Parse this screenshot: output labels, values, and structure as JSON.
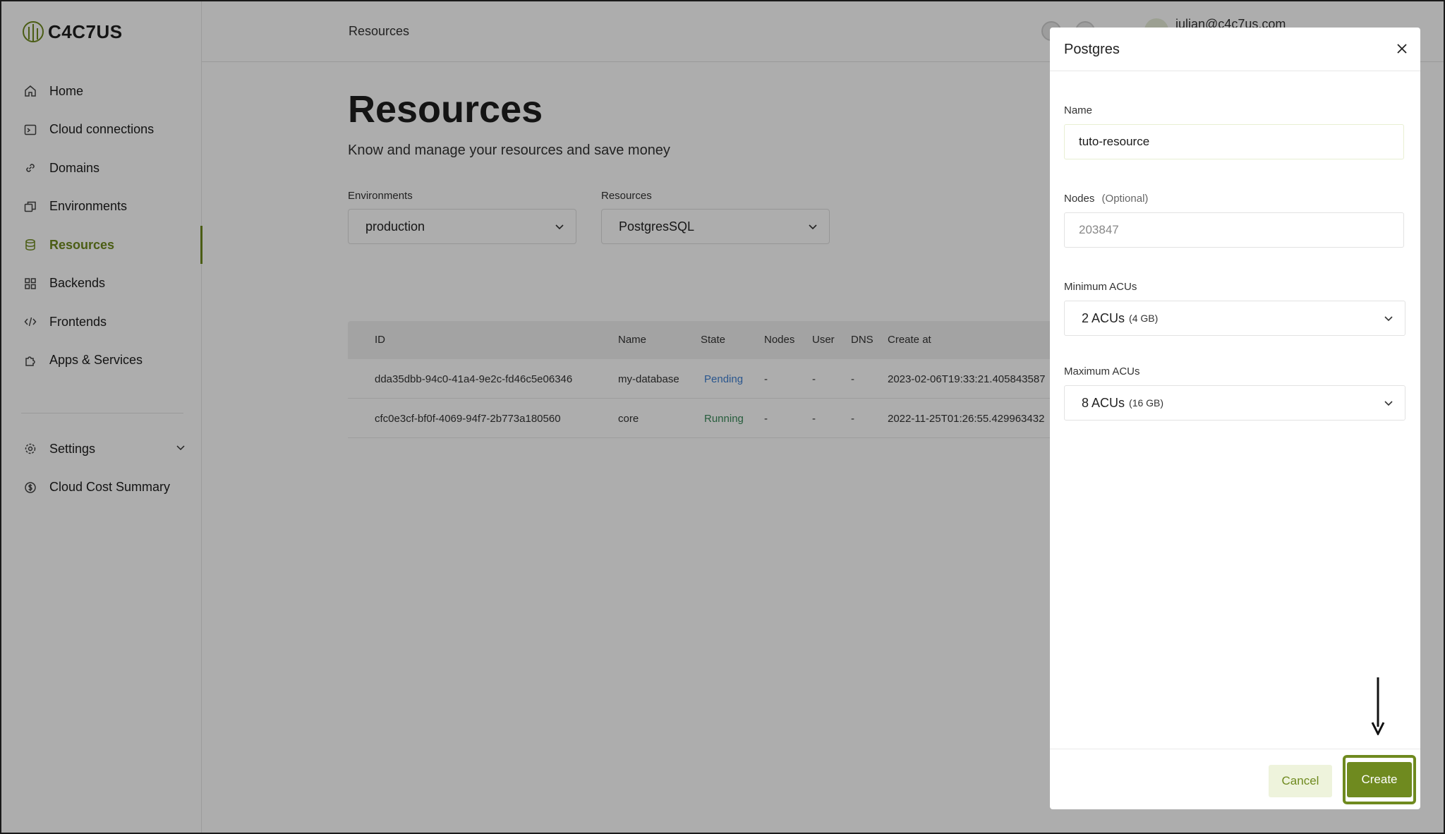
{
  "app": {
    "logo_text": "C4C7US"
  },
  "sidebar": {
    "items": [
      {
        "label": "Home",
        "icon": "home-icon"
      },
      {
        "label": "Cloud connections",
        "icon": "terminal-icon"
      },
      {
        "label": "Domains",
        "icon": "link-icon"
      },
      {
        "label": "Environments",
        "icon": "layers-icon"
      },
      {
        "label": "Resources",
        "icon": "database-icon",
        "active": true
      },
      {
        "label": "Backends",
        "icon": "grid-icon"
      },
      {
        "label": "Frontends",
        "icon": "code-icon"
      },
      {
        "label": "Apps & Services",
        "icon": "puzzle-icon"
      }
    ],
    "settings_label": "Settings",
    "cost_label": "Cloud Cost Summary"
  },
  "header": {
    "breadcrumb": "Resources",
    "user_email": "julian@c4c7us.com"
  },
  "main": {
    "title": "Resources",
    "subtitle": "Know and manage your resources and save money",
    "filters": {
      "env_label": "Environments",
      "env_value": "production",
      "res_label": "Resources",
      "res_value": "PostgresSQL"
    },
    "table": {
      "columns": [
        "ID",
        "Name",
        "State",
        "Nodes",
        "User",
        "DNS",
        "Create at"
      ],
      "rows": [
        [
          "dda35dbb-94c0-41a4-9e2c-fd46c5e06346",
          "my-database",
          "Pending",
          "-",
          "-",
          "-",
          "2023-02-06T19:33:21.405843587"
        ],
        [
          "cfc0e3cf-bf0f-4069-94f7-2b773a180560",
          "core",
          "Running",
          "-",
          "-",
          "-",
          "2022-11-25T01:26:55.429963432"
        ]
      ]
    }
  },
  "modal": {
    "title": "Postgres",
    "name_label": "Name",
    "name_value": "tuto-resource",
    "nodes_label": "Nodes",
    "nodes_optional": "(Optional)",
    "nodes_placeholder": "203847",
    "min_label": "Minimum ACUs",
    "min_value": "2 ACUs",
    "min_detail": "(4 GB)",
    "max_label": "Maximum ACUs",
    "max_value": "8 ACUs",
    "max_detail": "(16 GB)",
    "cancel_label": "Cancel",
    "create_label": "Create"
  },
  "colors": {
    "accent": "#6f8a1f",
    "pending": "#3f7fd1",
    "running": "#3a8a5a"
  }
}
